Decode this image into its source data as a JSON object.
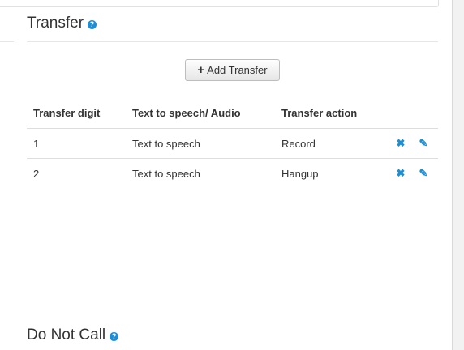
{
  "transfer_section": {
    "title": "Transfer",
    "help_glyph": "?",
    "add_button_label": "Add Transfer",
    "add_button_icon": "plus-icon",
    "columns": [
      "Transfer digit",
      "Text to speech/ Audio",
      "Transfer action",
      ""
    ],
    "rows": [
      {
        "digit": "1",
        "tts": "Text to speech",
        "action": "Record"
      },
      {
        "digit": "2",
        "tts": "Text to speech",
        "action": "Hangup"
      }
    ],
    "row_icons": {
      "delete": "close-icon",
      "edit": "pencil-icon"
    }
  },
  "dnc_section": {
    "title": "Do Not Call",
    "help_glyph": "?"
  },
  "colors": {
    "accent": "#1a8fd6",
    "text": "#333333",
    "border": "#dddddd",
    "background": "#f2f2f2"
  }
}
